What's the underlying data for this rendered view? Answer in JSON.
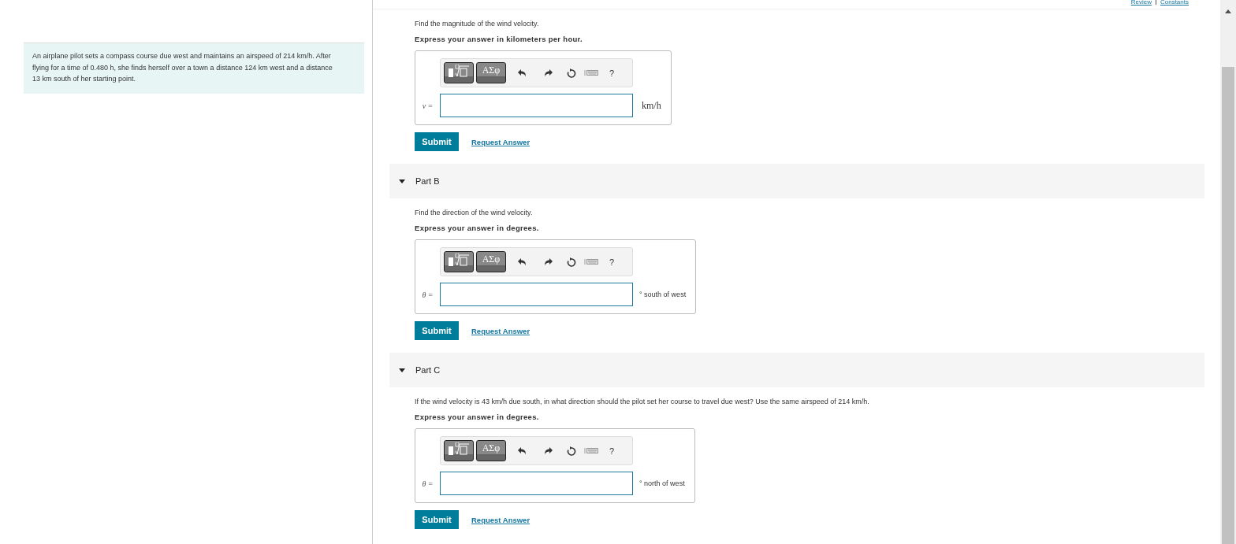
{
  "header_links": [
    "Review",
    "Constants"
  ],
  "problem": "An airplane pilot sets a compass course due west and maintains an airspeed of 214 km/h. After flying for a time of 0.480 h, she finds herself over a town a distance 124 km west and a distance 13 km south of her starting point.",
  "parts": [
    {
      "prompt": "Find the magnitude of the wind velocity.",
      "instruction": "Express your answer in kilometers per hour.",
      "symbols": "ΑΣφ",
      "help": "?",
      "variable": "v =",
      "unit": {
        "text": "km/h",
        "kind": "math"
      },
      "submit": "Submit",
      "request": "Request Answer"
    },
    {
      "title": "Part B",
      "expanded": true,
      "prompt": "Find the direction of the wind velocity.",
      "instruction": "Express your answer in degrees.",
      "symbols": "ΑΣφ",
      "help": "?",
      "variable": "θ =",
      "unit": {
        "text": "° south of west",
        "kind": "text"
      },
      "submit": "Submit",
      "request": "Request Answer"
    },
    {
      "title": "Part C",
      "expanded": true,
      "prompt": "If the wind velocity is 43 km/h due south, in what direction should the pilot set her course to travel due west? Use the same airspeed of 214 km/h.",
      "instruction": "Express your answer in degrees.",
      "symbols": "ΑΣφ",
      "help": "?",
      "variable": "θ =",
      "unit": {
        "text": "° north of west",
        "kind": "text"
      },
      "submit": "Submit",
      "request": "Request Answer"
    }
  ]
}
